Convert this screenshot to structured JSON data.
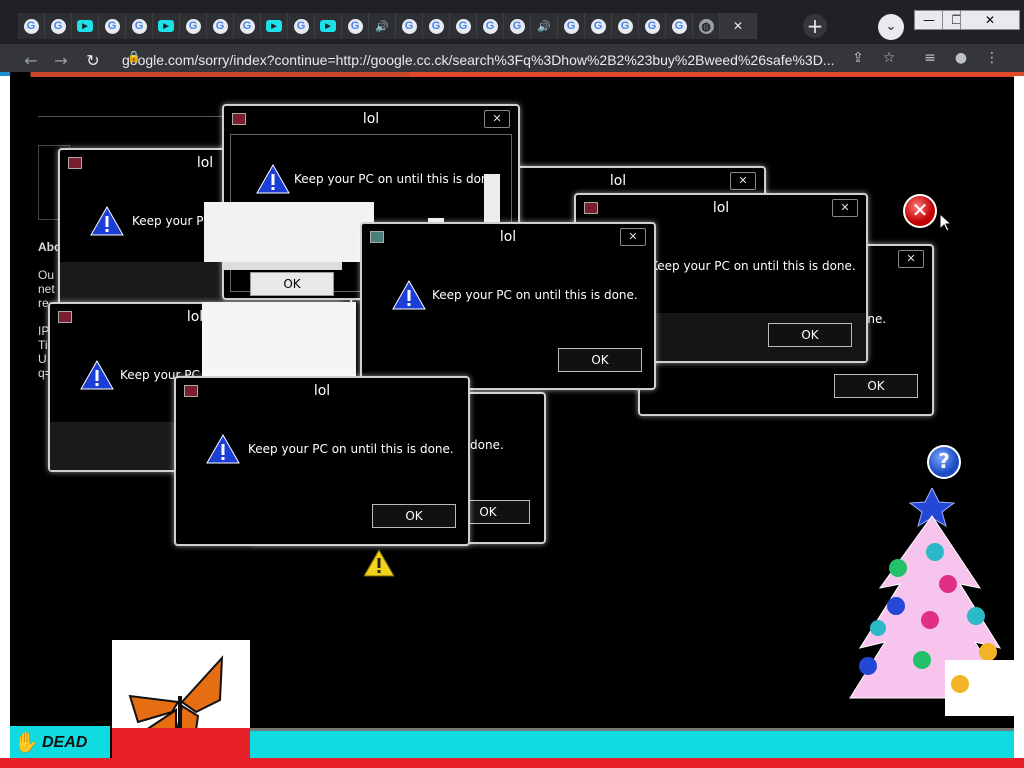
{
  "tabs": [
    "G",
    "G",
    "yt",
    "G",
    "G",
    "yt",
    "G",
    "G",
    "G",
    "yt",
    "G",
    "yt",
    "G",
    "snd",
    "G",
    "G",
    "G",
    "G",
    "G",
    "snd",
    "G",
    "G",
    "G",
    "G",
    "G",
    "globe"
  ],
  "new_tab_label": "+",
  "window_controls": {
    "minimize": "—",
    "maximize": "❐",
    "close": "✕"
  },
  "address": {
    "url": "google.com/sorry/index?continue=http://google.cc.ck/search%3Fq%3Dhow%2B2%23buy%2Bweed%26safe%3D..."
  },
  "page_text_lines": [
    "Abo",
    "Ou",
    "net",
    "re",
    "",
    "IP",
    "Ti",
    "U",
    "q="
  ],
  "dialog_title": "lol",
  "dialog_message": "Keep your PC on until this is done.",
  "ok_label": "OK",
  "dead_label": "DEAD",
  "colors": {
    "cyan": "#10dbe0",
    "red": "#e8202a",
    "warn_blue": "#1d3ed6"
  }
}
